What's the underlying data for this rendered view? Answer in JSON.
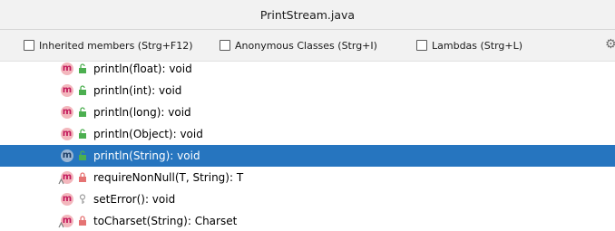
{
  "window": {
    "title": "PrintStream.java"
  },
  "options": {
    "inherited": "Inherited members (Strg+F12)",
    "anonymous": "Anonymous Classes (Strg+I)",
    "lambdas": "Lambdas (Strg+L)"
  },
  "members": [
    {
      "icon": "m",
      "visibility": "public",
      "label": "println(float): void",
      "selected": false
    },
    {
      "icon": "m",
      "visibility": "public",
      "label": "println(int): void",
      "selected": false
    },
    {
      "icon": "m",
      "visibility": "public",
      "label": "println(long): void",
      "selected": false
    },
    {
      "icon": "m",
      "visibility": "public",
      "label": "println(Object): void",
      "selected": false
    },
    {
      "icon": "m",
      "visibility": "public",
      "label": "println(String): void",
      "selected": true
    },
    {
      "icon": "m",
      "visibility": "private",
      "label": "requireNonNull(T, String): T",
      "selected": false
    },
    {
      "icon": "m",
      "visibility": "protected",
      "label": "setError(): void",
      "selected": false
    },
    {
      "icon": "m",
      "visibility": "private",
      "label": "toCharset(String): Charset",
      "selected": false
    }
  ],
  "colors": {
    "selection": "#2675bf",
    "method_icon_bg": "#f3b7bd",
    "public": "#4caf50",
    "private": "#e57373",
    "protected": "#9e9e9e"
  }
}
